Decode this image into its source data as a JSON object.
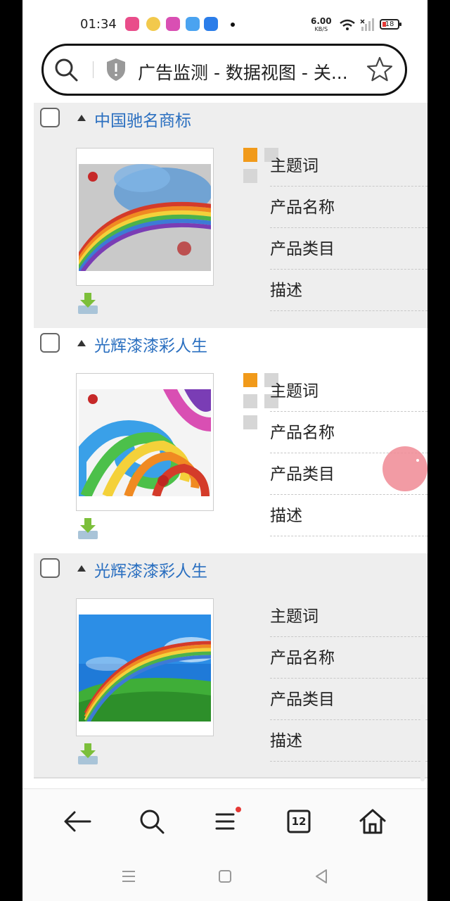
{
  "status_bar": {
    "time": "01:34",
    "net_speed_value": "6.00",
    "net_speed_unit": "KB/S",
    "battery": "18"
  },
  "url_bar": {
    "title": "广告监测 - 数据视图 - 关..."
  },
  "items": [
    {
      "title": "中国驰名商标",
      "fields": [
        "主题词",
        "产品名称",
        "产品类目",
        "描述"
      ]
    },
    {
      "title": "光辉漆漆彩人生",
      "fields": [
        "主题词",
        "产品名称",
        "产品类目",
        "描述"
      ]
    },
    {
      "title": "光辉漆漆彩人生",
      "fields": [
        "主题词",
        "产品名称",
        "产品类目",
        "描述"
      ]
    }
  ],
  "bottom_nav": {
    "tab_count": "12"
  },
  "icons": {
    "search": "search-icon",
    "shield": "shield-icon",
    "star": "star-icon",
    "back": "back-arrow-icon",
    "menu": "menu-icon",
    "tabs": "tabs-icon",
    "home": "home-icon",
    "download": "download-icon"
  },
  "colors": {
    "link_blue": "#2a6fc0",
    "orange_square": "#f19a1a",
    "notification_red": "#e53935"
  }
}
